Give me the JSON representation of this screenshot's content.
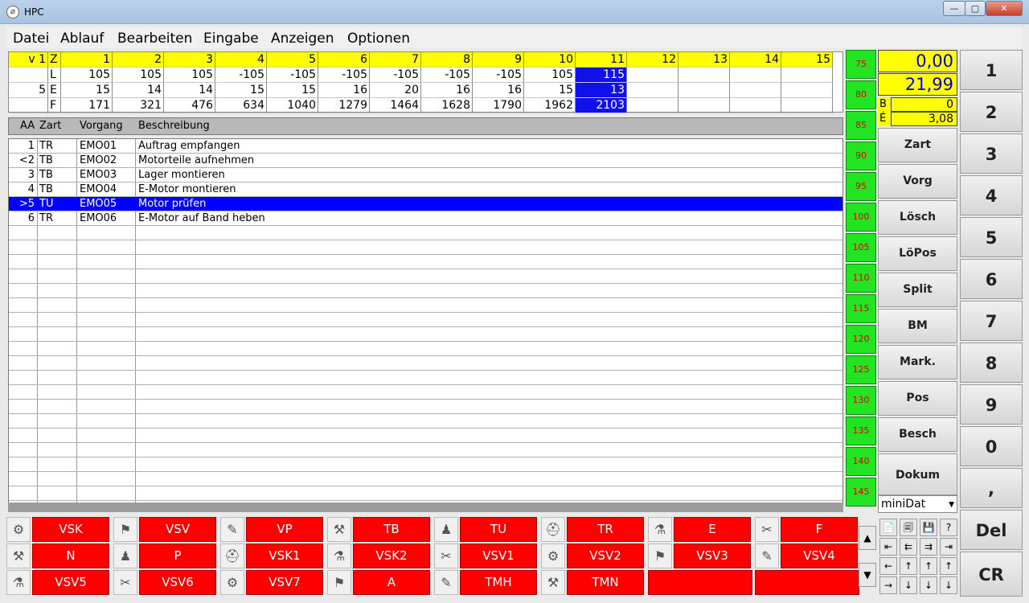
{
  "window": {
    "title": "HPC",
    "min_label": "—",
    "max_label": "▢",
    "close_label": "✕"
  },
  "menu": [
    "Datei",
    "Ablauf",
    "Bearbeiten",
    "Eingabe",
    "Anzeigen",
    "Optionen"
  ],
  "top_table": {
    "header_v": "v 1",
    "header_z": "Z",
    "columns": [
      "1",
      "2",
      "3",
      "4",
      "5",
      "6",
      "7",
      "8",
      "9",
      "10",
      "11",
      "12",
      "13",
      "14",
      "15"
    ],
    "rows": [
      {
        "pre": "",
        "z": "L",
        "values": [
          "105",
          "105",
          "105",
          "-105",
          "-105",
          "-105",
          "-105",
          "-105",
          "-105",
          "105",
          "115",
          "",
          "",
          "",
          ""
        ]
      },
      {
        "pre": "5",
        "z": "E",
        "values": [
          "15",
          "14",
          "14",
          "15",
          "15",
          "16",
          "20",
          "16",
          "16",
          "15",
          "13",
          "",
          "",
          "",
          ""
        ]
      },
      {
        "pre": "",
        "z": "F",
        "values": [
          "171",
          "321",
          "476",
          "634",
          "1040",
          "1279",
          "1464",
          "1628",
          "1790",
          "1962",
          "2103",
          "",
          "",
          "",
          ""
        ]
      }
    ],
    "highlight_column": "11"
  },
  "grid": {
    "headers": [
      "AA",
      "Zart",
      "Vorgang",
      "Beschreibung"
    ],
    "rows": [
      {
        "aa": "1",
        "zart": "TR",
        "vorgang": "EMO01",
        "beschreibung": "Auftrag empfangen",
        "selected": false
      },
      {
        "aa": "<2",
        "zart": "TB",
        "vorgang": "EMO02",
        "beschreibung": "Motorteile aufnehmen",
        "selected": false
      },
      {
        "aa": "3",
        "zart": "TB",
        "vorgang": "EMO03",
        "beschreibung": "Lager montieren",
        "selected": false
      },
      {
        "aa": "4",
        "zart": "TB",
        "vorgang": "EMO04",
        "beschreibung": "E-Motor montieren",
        "selected": false
      },
      {
        "aa": ">5",
        "zart": "TU",
        "vorgang": "EMO05",
        "beschreibung": "Motor prüfen",
        "selected": true
      },
      {
        "aa": "6",
        "zart": "TR",
        "vorgang": "EMO06",
        "beschreibung": "E-Motor auf Band heben",
        "selected": false
      }
    ]
  },
  "green_column": [
    "75",
    "80",
    "85",
    "90",
    "95",
    "100",
    "105",
    "110",
    "115",
    "120",
    "125",
    "130",
    "135",
    "140",
    "145"
  ],
  "display": {
    "value1": "0,00",
    "value2": "21,99",
    "b_label": "B",
    "b_value": "0",
    "e_label": "É",
    "e_value": "3,08"
  },
  "function_buttons": [
    "Zart",
    "Vorg",
    "Lösch",
    "LöPos",
    "Split",
    "BM",
    "Mark.",
    "Pos",
    "Besch",
    "Dokum"
  ],
  "dropdown": {
    "value": "miniDat"
  },
  "numpad": [
    "1",
    "2",
    "3",
    "4",
    "5",
    "6",
    "7",
    "8",
    "9",
    "0",
    ",",
    "Del",
    "CR"
  ],
  "type_buttons": [
    [
      "VSK",
      "VSV",
      "VP",
      "TB",
      "TU",
      "TR",
      "E",
      "F"
    ],
    [
      "N",
      "P",
      "VSK1",
      "VSK2",
      "VSV1",
      "VSV2",
      "VSV3",
      "VSV4"
    ],
    [
      "VSV5",
      "VSV6",
      "VSV7",
      "A",
      "TMH",
      "TMN",
      "",
      ""
    ]
  ],
  "scroll_arrows": {
    "up": "▲",
    "down": "▼"
  },
  "icon_colors": {
    "red": "#ff0000",
    "green": "#22e422",
    "yellow": "#ffff00",
    "selection": "#0000ff"
  }
}
